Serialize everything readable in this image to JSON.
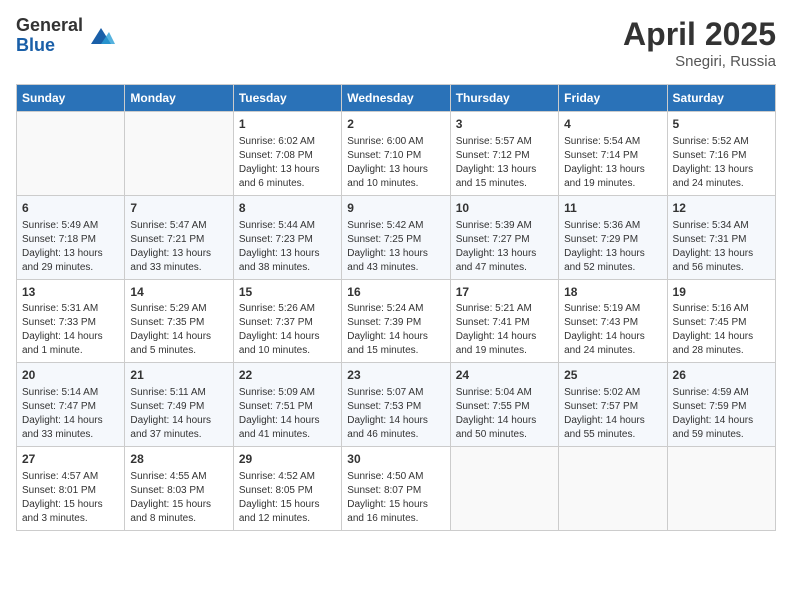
{
  "logo": {
    "general": "General",
    "blue": "Blue"
  },
  "title": "April 2025",
  "subtitle": "Snegiri, Russia",
  "days_of_week": [
    "Sunday",
    "Monday",
    "Tuesday",
    "Wednesday",
    "Thursday",
    "Friday",
    "Saturday"
  ],
  "weeks": [
    [
      {
        "day": "",
        "info": ""
      },
      {
        "day": "",
        "info": ""
      },
      {
        "day": "1",
        "info": "Sunrise: 6:02 AM\nSunset: 7:08 PM\nDaylight: 13 hours and 6 minutes."
      },
      {
        "day": "2",
        "info": "Sunrise: 6:00 AM\nSunset: 7:10 PM\nDaylight: 13 hours and 10 minutes."
      },
      {
        "day": "3",
        "info": "Sunrise: 5:57 AM\nSunset: 7:12 PM\nDaylight: 13 hours and 15 minutes."
      },
      {
        "day": "4",
        "info": "Sunrise: 5:54 AM\nSunset: 7:14 PM\nDaylight: 13 hours and 19 minutes."
      },
      {
        "day": "5",
        "info": "Sunrise: 5:52 AM\nSunset: 7:16 PM\nDaylight: 13 hours and 24 minutes."
      }
    ],
    [
      {
        "day": "6",
        "info": "Sunrise: 5:49 AM\nSunset: 7:18 PM\nDaylight: 13 hours and 29 minutes."
      },
      {
        "day": "7",
        "info": "Sunrise: 5:47 AM\nSunset: 7:21 PM\nDaylight: 13 hours and 33 minutes."
      },
      {
        "day": "8",
        "info": "Sunrise: 5:44 AM\nSunset: 7:23 PM\nDaylight: 13 hours and 38 minutes."
      },
      {
        "day": "9",
        "info": "Sunrise: 5:42 AM\nSunset: 7:25 PM\nDaylight: 13 hours and 43 minutes."
      },
      {
        "day": "10",
        "info": "Sunrise: 5:39 AM\nSunset: 7:27 PM\nDaylight: 13 hours and 47 minutes."
      },
      {
        "day": "11",
        "info": "Sunrise: 5:36 AM\nSunset: 7:29 PM\nDaylight: 13 hours and 52 minutes."
      },
      {
        "day": "12",
        "info": "Sunrise: 5:34 AM\nSunset: 7:31 PM\nDaylight: 13 hours and 56 minutes."
      }
    ],
    [
      {
        "day": "13",
        "info": "Sunrise: 5:31 AM\nSunset: 7:33 PM\nDaylight: 14 hours and 1 minute."
      },
      {
        "day": "14",
        "info": "Sunrise: 5:29 AM\nSunset: 7:35 PM\nDaylight: 14 hours and 5 minutes."
      },
      {
        "day": "15",
        "info": "Sunrise: 5:26 AM\nSunset: 7:37 PM\nDaylight: 14 hours and 10 minutes."
      },
      {
        "day": "16",
        "info": "Sunrise: 5:24 AM\nSunset: 7:39 PM\nDaylight: 14 hours and 15 minutes."
      },
      {
        "day": "17",
        "info": "Sunrise: 5:21 AM\nSunset: 7:41 PM\nDaylight: 14 hours and 19 minutes."
      },
      {
        "day": "18",
        "info": "Sunrise: 5:19 AM\nSunset: 7:43 PM\nDaylight: 14 hours and 24 minutes."
      },
      {
        "day": "19",
        "info": "Sunrise: 5:16 AM\nSunset: 7:45 PM\nDaylight: 14 hours and 28 minutes."
      }
    ],
    [
      {
        "day": "20",
        "info": "Sunrise: 5:14 AM\nSunset: 7:47 PM\nDaylight: 14 hours and 33 minutes."
      },
      {
        "day": "21",
        "info": "Sunrise: 5:11 AM\nSunset: 7:49 PM\nDaylight: 14 hours and 37 minutes."
      },
      {
        "day": "22",
        "info": "Sunrise: 5:09 AM\nSunset: 7:51 PM\nDaylight: 14 hours and 41 minutes."
      },
      {
        "day": "23",
        "info": "Sunrise: 5:07 AM\nSunset: 7:53 PM\nDaylight: 14 hours and 46 minutes."
      },
      {
        "day": "24",
        "info": "Sunrise: 5:04 AM\nSunset: 7:55 PM\nDaylight: 14 hours and 50 minutes."
      },
      {
        "day": "25",
        "info": "Sunrise: 5:02 AM\nSunset: 7:57 PM\nDaylight: 14 hours and 55 minutes."
      },
      {
        "day": "26",
        "info": "Sunrise: 4:59 AM\nSunset: 7:59 PM\nDaylight: 14 hours and 59 minutes."
      }
    ],
    [
      {
        "day": "27",
        "info": "Sunrise: 4:57 AM\nSunset: 8:01 PM\nDaylight: 15 hours and 3 minutes."
      },
      {
        "day": "28",
        "info": "Sunrise: 4:55 AM\nSunset: 8:03 PM\nDaylight: 15 hours and 8 minutes."
      },
      {
        "day": "29",
        "info": "Sunrise: 4:52 AM\nSunset: 8:05 PM\nDaylight: 15 hours and 12 minutes."
      },
      {
        "day": "30",
        "info": "Sunrise: 4:50 AM\nSunset: 8:07 PM\nDaylight: 15 hours and 16 minutes."
      },
      {
        "day": "",
        "info": ""
      },
      {
        "day": "",
        "info": ""
      },
      {
        "day": "",
        "info": ""
      }
    ]
  ]
}
